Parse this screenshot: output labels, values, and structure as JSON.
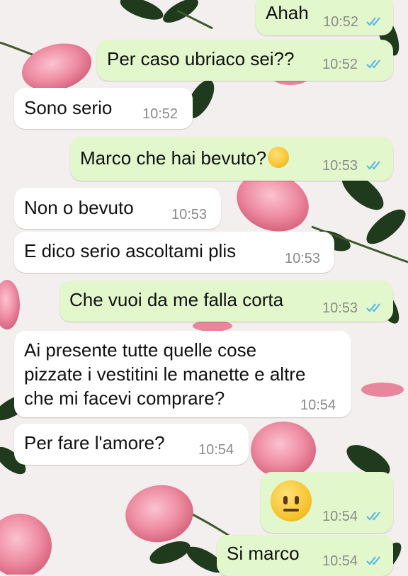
{
  "theme": {
    "outgoing_bubble": "#e2f7cb",
    "incoming_bubble": "#ffffff",
    "read_ticks": "#4fb6ec",
    "background": "#f3eeee",
    "rose_pink": "#ee8da3",
    "leaf_green": "#1f3a1c"
  },
  "messages": [
    {
      "dir": "out",
      "text": "Ahah",
      "time": "10:52",
      "status": "read"
    },
    {
      "dir": "out",
      "text": "Per caso ubriaco sei??",
      "time": "10:52",
      "status": "read"
    },
    {
      "dir": "in",
      "text": "Sono serio",
      "time": "10:52"
    },
    {
      "dir": "out",
      "text": "Marco che hai bevuto?",
      "emoji": "grinning-sweat-emoji",
      "time": "10:53",
      "status": "read"
    },
    {
      "dir": "in",
      "text": "Non o bevuto",
      "time": "10:53"
    },
    {
      "dir": "in",
      "text": "E dico serio ascoltami plis",
      "time": "10:53"
    },
    {
      "dir": "out",
      "text": "Che vuoi da me falla corta",
      "time": "10:53",
      "status": "read"
    },
    {
      "dir": "in",
      "lines": [
        "Ai presente tutte quelle cose",
        "pizzate i vestitini le manette e altre",
        "che mi facevi comprare?"
      ],
      "time": "10:54"
    },
    {
      "dir": "in",
      "text": "Per fare l'amore?",
      "time": "10:54"
    },
    {
      "dir": "out",
      "emoji": "neutral-face-emoji",
      "time": "10:54",
      "status": "read"
    },
    {
      "dir": "out",
      "text": "Si marco",
      "time": "10:54",
      "status": "read"
    }
  ]
}
